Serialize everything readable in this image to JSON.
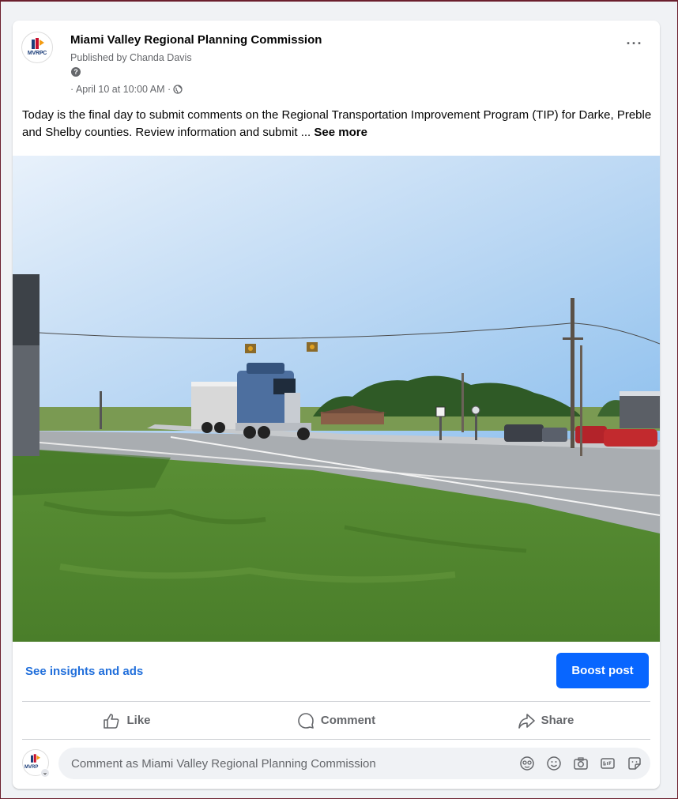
{
  "post": {
    "page_name": "Miami Valley Regional Planning Commission",
    "published_by": "Published by Chanda Davis",
    "help_mark": "?",
    "timestamp": "· April 10 at 10:00 AM ·",
    "more_label": "···",
    "text": "Today is the final day to submit comments on the Regional Transportation Improvement Program (TIP) for Darke, Preble and Shelby counties. Review information and submit ... ",
    "see_more": "See more",
    "avatar_text": "MVRPC",
    "avatar_small_text": "MVRP",
    "icons": {
      "audience": "globe-icon",
      "more": "more-horizontal-icon"
    }
  },
  "insights": {
    "link": "See insights and ads",
    "boost": "Boost post"
  },
  "actions": [
    {
      "label": "Like",
      "icon": "thumbs-up-icon"
    },
    {
      "label": "Comment",
      "icon": "comment-bubble-icon"
    },
    {
      "label": "Share",
      "icon": "share-arrow-icon"
    }
  ],
  "comment": {
    "placeholder": "Comment as Miami Valley Regional Planning Commission",
    "chevron": "⌄",
    "icons": [
      "avatar-sticker-icon",
      "emoji-icon",
      "camera-icon",
      "gif-icon",
      "sticker-icon"
    ]
  },
  "colors": {
    "accent": "#0866ff",
    "link": "#216fdb",
    "secondary_text": "#65676b"
  }
}
